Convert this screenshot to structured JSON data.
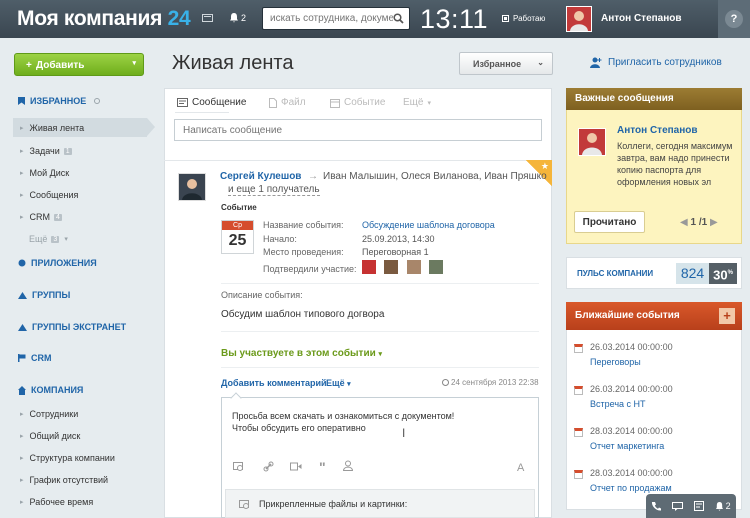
{
  "header": {
    "logo_text": "Моя компания",
    "logo_num": "24",
    "notif_count": "2",
    "search_placeholder": "искать сотрудника, документ",
    "clock": "13:11",
    "work_status": "Работаю",
    "user_name": "Антон Степанов",
    "help": "?"
  },
  "sidebar": {
    "add_label": "Добавить",
    "favorites": "ИЗБРАННОЕ",
    "items": [
      {
        "label": "Живая лента"
      },
      {
        "label": "Задачи",
        "badge": "1"
      },
      {
        "label": "Мой Диск"
      },
      {
        "label": "Сообщения"
      },
      {
        "label": "CRM",
        "badge": "4"
      },
      {
        "label": "Ещё",
        "badge": "3"
      }
    ],
    "apps": "ПРИЛОЖЕНИЯ",
    "groups": "ГРУППЫ",
    "extranet": "ГРУППЫ ЭКСТРАНЕТ",
    "crm": "CRM",
    "company": "КОМПАНИЯ",
    "company_items": [
      "Сотрудники",
      "Общий диск",
      "Структура компании",
      "График отсутствий",
      "Рабочее время"
    ]
  },
  "main": {
    "title": "Живая лента",
    "fav_label": "Избранное",
    "tabs": [
      "Сообщение",
      "Файл",
      "Событие",
      "Ещё"
    ],
    "msg_placeholder": "Написать сообщение",
    "post": {
      "author": "Сергей Кулешов",
      "recipients": "Иван Малышин, Олеся Виланова, Иван Пряшко",
      "more_recipients": "и еще 1 получатель",
      "type": "Событие",
      "cal_day": "Ср",
      "cal_num": "25",
      "fields": {
        "name_label": "Название события:",
        "name_value": "Обсуждение шаблона договора",
        "start_label": "Начало:",
        "start_value": "25.09.2013, 14:30",
        "place_label": "Место проведения:",
        "place_value": "Переговорная 1",
        "confirmed_label": "Подтвердили участие:"
      },
      "desc_label": "Описание события:",
      "desc": "Обсудим шаблон типового догвора",
      "participate": "Вы участвуете в этом событии",
      "add_comment": "Добавить комментарий",
      "more": "Ещё",
      "date": "24 сентября 2013 22:38",
      "comment_line1": "Просьба всем скачать и ознакомиться с документом!",
      "comment_line2": "Чтобы обсудить его оперативно",
      "attach_label": "Прикрепленные файлы и картинки:"
    }
  },
  "right": {
    "invite": "Пригласить сотрудников",
    "important_title": "Важные сообщения",
    "important_author": "Антон Степанов",
    "important_text": [
      "Коллеги, сегодня максимум",
      "завтра, вам надо принести",
      "копию паспорта для",
      "оформления новых эл"
    ],
    "read_label": "Прочитано",
    "pager": "1 /1",
    "pulse_label": "ПУЛЬС КОМПАНИИ",
    "pulse_num": "824",
    "pulse_pct": "30",
    "pulse_pct_sign": "%",
    "events_title": "Ближайшие события",
    "events": [
      {
        "date": "26.03.2014 00:00:00",
        "name": "Переговоры"
      },
      {
        "date": "26.03.2014 00:00:00",
        "name": "Встреча с НТ"
      },
      {
        "date": "28.03.2014 00:00:00",
        "name": "Отчет маркетинга"
      },
      {
        "date": "28.03.2014 00:00:00",
        "name": "Отчет по продажам"
      }
    ],
    "dock_count": "2"
  },
  "colors": {
    "accent": "#2065a8",
    "logo_num": "#39b1e8",
    "add_green": "#7cbd25",
    "events_orange": "#d9582a"
  }
}
